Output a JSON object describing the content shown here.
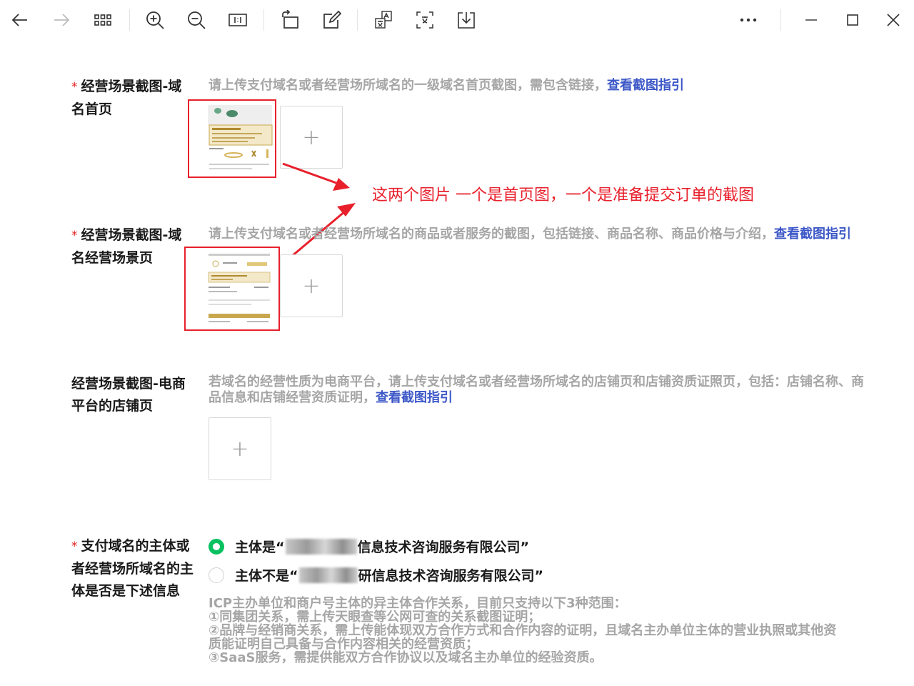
{
  "toolbar": {
    "icons": [
      "back-arrow-icon",
      "forward-arrow-icon",
      "grid-view-icon",
      "zoom-in-icon",
      "zoom-out-icon",
      "actual-size-icon",
      "rotate-icon",
      "edit-icon",
      "translate-icon",
      "ocr-icon",
      "save-icon",
      "more-icon",
      "minimize-icon",
      "maximize-icon",
      "close-icon"
    ]
  },
  "fields": {
    "homepage": {
      "required_mark": "*",
      "label": "经营场景截图-域名首页",
      "hint": "请上传支付域名或者经营场所域名的一级域名首页截图，需包含链接，",
      "link": "查看截图指引"
    },
    "scene": {
      "required_mark": "*",
      "label": "经营场景截图-域名经营场景页",
      "hint": "请上传支付域名或者经营场所域名的商品或者服务的截图，包括链接、商品名称、商品价格与介绍，",
      "link": "查看截图指引"
    },
    "shop": {
      "label": "经营场景截图-电商平台的店铺页",
      "hint": "若域名的经营性质为电商平台，请上传支付域名或者经营场所域名的店铺页和店铺资质证照页，包括：店铺名称、商品信息和店铺经营资质证明，",
      "link": "查看截图指引"
    },
    "subject": {
      "required_mark": "*",
      "label": "支付域名的主体或者经营场所域名的主体是否是下述信息",
      "options": [
        {
          "prefix": "主体是“",
          "suffix": "信息技术咨询服务有限公司”",
          "selected": true
        },
        {
          "prefix": "主体不是“",
          "suffix": "研信息技术咨询服务有限公司”",
          "selected": false
        }
      ],
      "notes": [
        "ICP主办单位和商户号主体的异主体合作关系，目前只支持以下3种范围：",
        "①同集团关系，需上传天眼查等公网可查的关系截图证明；",
        "②品牌与经销商关系，需上传能体现双方合作方式和合作内容的证明，且域名主办单位主体的营业执照或其他资",
        "质能证明自己具备与合作内容相关的经营资质；",
        "③SaaS服务，需提供能双方合作协议以及域名主办单位的经验资质。"
      ]
    }
  },
  "annotation": {
    "text": "这两个图片  一个是首页图，一个是准备提交订单的截图",
    "color": "#e8202c"
  },
  "upload_plus": "+",
  "colors": {
    "link": "#3c57c7",
    "hint": "#a6a6a6",
    "radio_selected": "#07c160",
    "highlight_red": "#e8202c"
  }
}
